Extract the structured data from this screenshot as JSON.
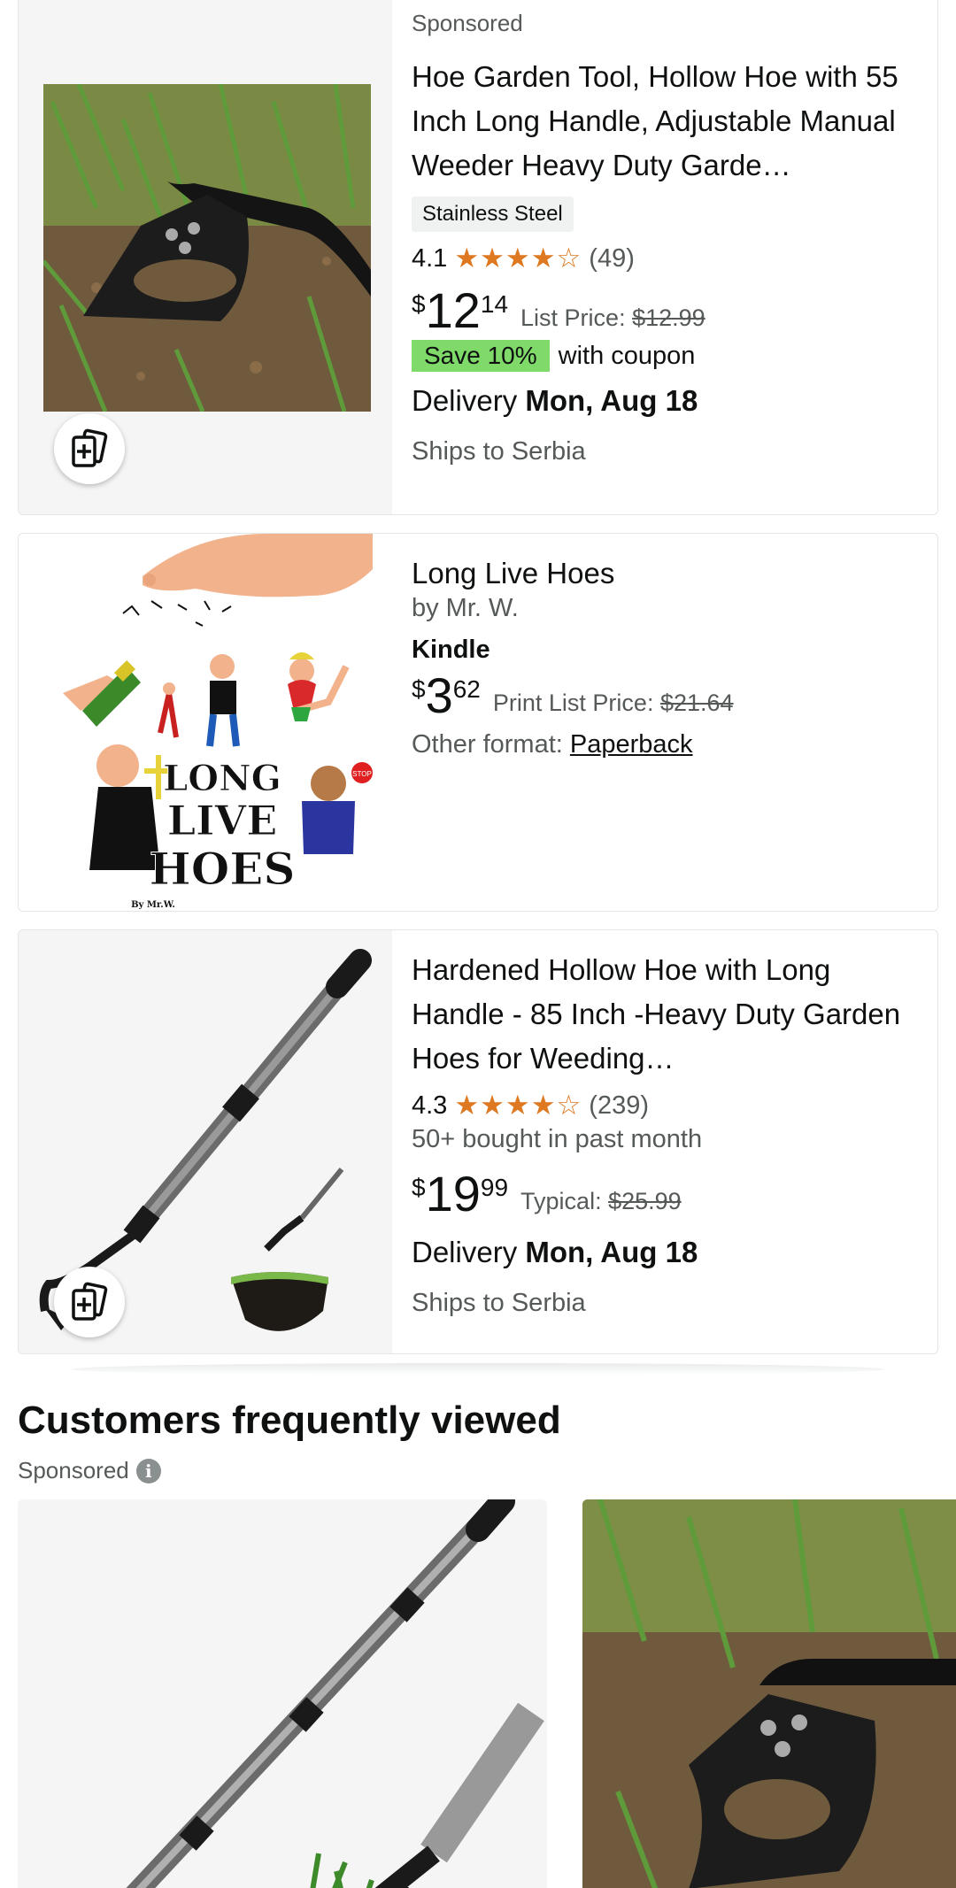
{
  "results": [
    {
      "sponsored_label": "Sponsored",
      "title": "Hoe Garden Tool, Hollow Hoe with 55 Inch Long Handle, Adjustable Manual Weeder Heavy Duty Garde…",
      "badge": "Stainless Steel",
      "rating": "4.1",
      "rating_count": "(49)",
      "price_symbol": "$",
      "price_whole": "12",
      "price_fraction": "14",
      "list_price_label": "List Price:",
      "list_price": "$12.99",
      "coupon_badge": "Save 10%",
      "coupon_text": "with coupon",
      "delivery_label": "Delivery",
      "delivery_date": "Mon, Aug 18",
      "ships_to": "Ships to Serbia",
      "image_icon": "hoe-photo"
    },
    {
      "title": "Long Live Hoes",
      "author": "by Mr. W.",
      "format": "Kindle",
      "price_symbol": "$",
      "price_whole": "3",
      "price_fraction": "62",
      "list_price_label": "Print List Price:",
      "list_price": "$21.64",
      "other_format_label": "Other format:",
      "other_format_link": "Paperback",
      "cover_lines": [
        "LONG",
        "LIVE",
        "HOES"
      ],
      "cover_byline": "By Mr.W.",
      "cover_stop": "STOP"
    },
    {
      "title": "Hardened Hollow Hoe with Long Handle - 85 Inch -Heavy Duty Garden Hoes for Weeding…",
      "rating": "4.3",
      "rating_count": "(239)",
      "bought": "50+ bought in past month",
      "price_symbol": "$",
      "price_whole": "19",
      "price_fraction": "99",
      "list_price_label": "Typical:",
      "list_price": "$25.99",
      "delivery_label": "Delivery",
      "delivery_date": "Mon, Aug 18",
      "ships_to": "Ships to Serbia"
    }
  ],
  "section": {
    "title": "Customers frequently viewed",
    "sponsored_label": "Sponsored",
    "info_glyph": "i"
  },
  "colors": {
    "star": "#de7921",
    "coupon": "#7fda69",
    "muted_text": "#565959"
  },
  "icons": {
    "add_to_compare": "add-to-list-icon",
    "info": "info-icon"
  }
}
